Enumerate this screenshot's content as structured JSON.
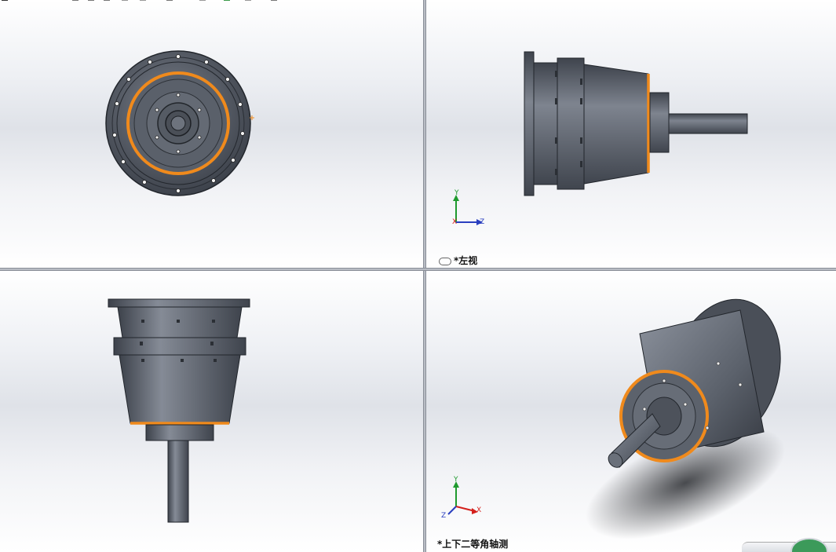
{
  "viewports": {
    "top_left": {
      "label": ""
    },
    "top_right": {
      "label": "*左视"
    },
    "bottom_left": {
      "label": ""
    },
    "bottom_right": {
      "label": "*上下二等角轴测"
    }
  },
  "triad": {
    "x_label": "X",
    "y_label": "Y",
    "z_label": "Z"
  },
  "colors": {
    "part_body": "#5e6470",
    "part_dark": "#3a3f48",
    "part_light": "#8a909c",
    "highlight_edge": "#f08a1c",
    "triad_x": "#d4201c",
    "triad_y": "#1f9a2e",
    "triad_z": "#2a3fbf"
  },
  "icons": [
    "link-icon",
    "coordinate-triad-icon",
    "view-orientation-icon"
  ]
}
